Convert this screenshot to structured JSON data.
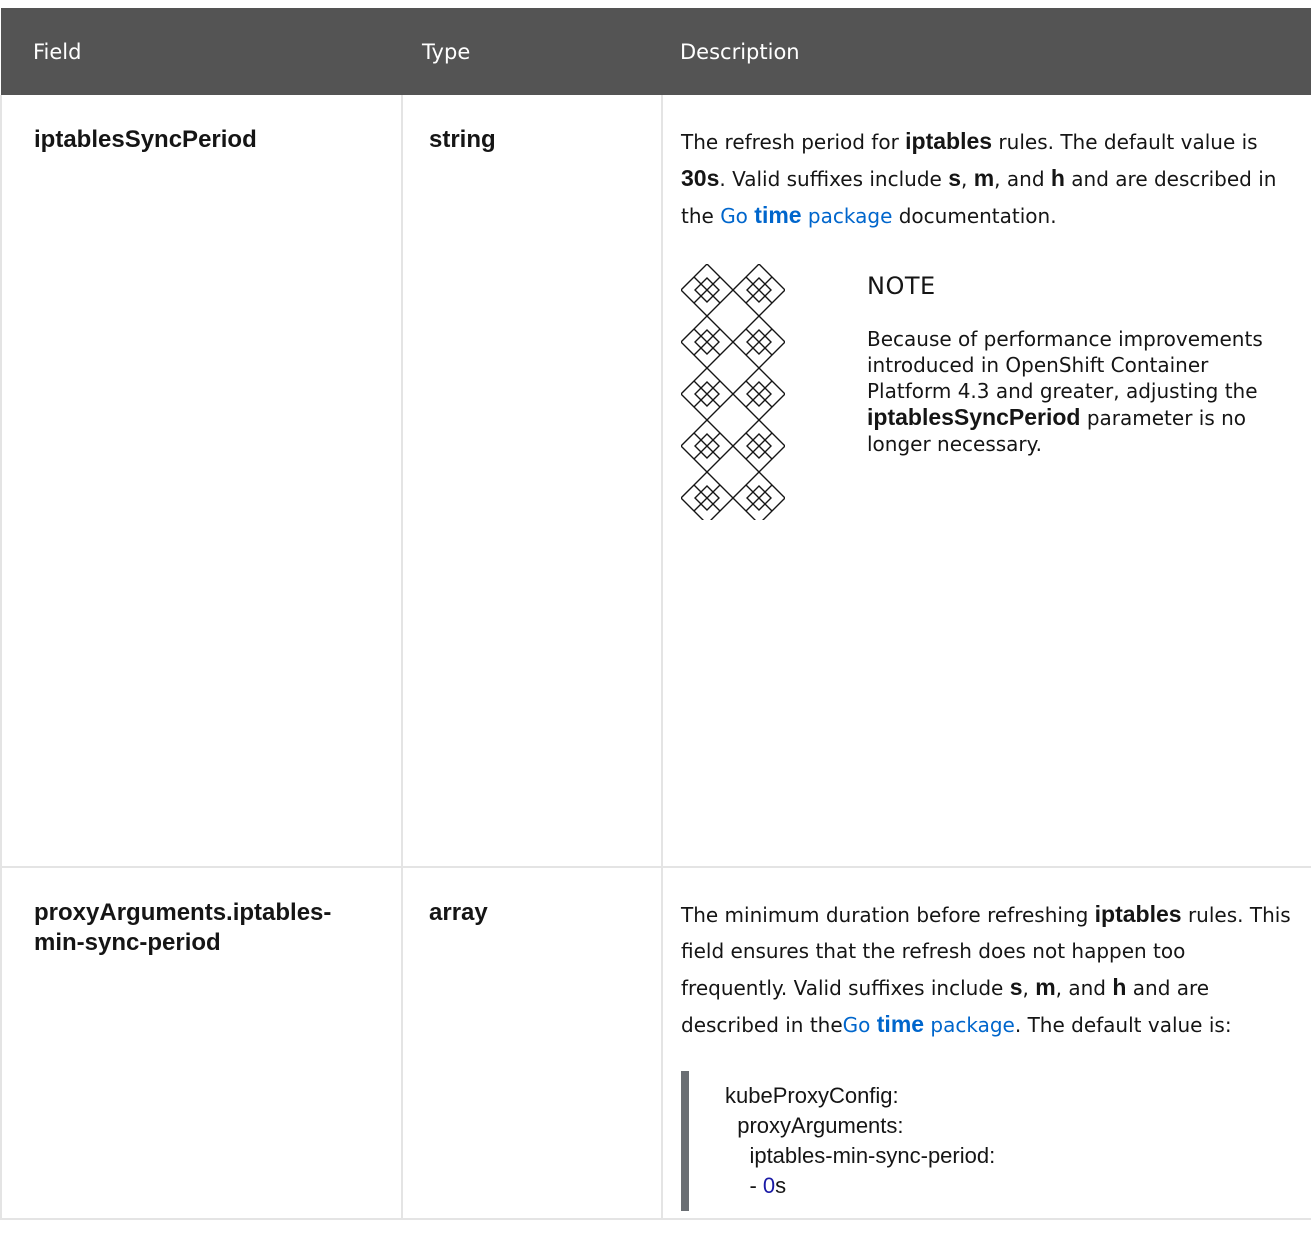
{
  "table": {
    "headers": {
      "field": "Field",
      "type": "Type",
      "description": "Description"
    },
    "rows": [
      {
        "field": "iptablesSyncPeriod",
        "type": "string",
        "description": {
          "p1_text1": "The refresh period for ",
          "p1_lit1": "iptables",
          "p1_text2": " rules. The default value is ",
          "p1_lit2": "30s",
          "p1_text3": ". Valid suffixes include ",
          "p1_lit3": "s",
          "p1_text4": ", ",
          "p1_lit4": "m",
          "p1_text5": ", and ",
          "p1_lit5": "h",
          "p1_text6": " and are described in the ",
          "link_go": "Go ",
          "link_time": "time",
          "link_package": " package",
          "p1_text7": " documentation."
        },
        "note": {
          "title": "NOTE",
          "text1": "Because of performance improvements introduced in OpenShift Container Platform 4.3 and greater, adjusting the ",
          "lit": "iptablesSyncPeriod",
          "text2": " parameter is no longer necessary.",
          "icon": "note-pattern-icon"
        }
      },
      {
        "field": "proxyArguments.iptables-min-sync-period",
        "type": "array",
        "description": {
          "p1_text1": "The minimum duration before refreshing ",
          "p1_lit1": "iptables",
          "p1_text2": " rules. This field ensures that the refresh does not happen too frequently. Valid suffixes include ",
          "p1_lit2": "s",
          "p1_text3": ", ",
          "p1_lit3": "m",
          "p1_text4": ", and ",
          "p1_lit4": "h",
          "p1_text5": " and are described in the",
          "link_go": "Go ",
          "link_time": "time",
          "link_package": " package",
          "p1_text6": ". The default value is:"
        },
        "code": {
          "line1": "kubeProxyConfig:",
          "line2": "  proxyArguments:",
          "line3": "    iptables-min-sync-period:",
          "line4_prefix": "    - ",
          "line4_num": "0",
          "line4_suffix": "s"
        }
      }
    ]
  },
  "colors": {
    "header_bg": "#545454",
    "link": "#0066cc",
    "border": "#e4e4e4",
    "code_bar": "#6a6e73"
  }
}
